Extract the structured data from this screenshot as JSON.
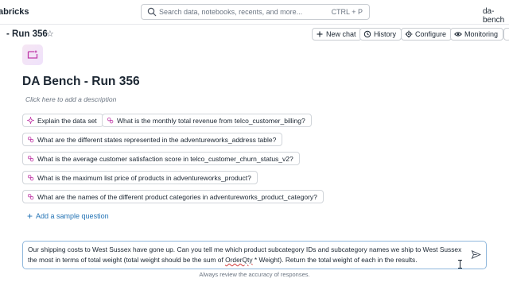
{
  "topbar": {
    "brand": "abricks",
    "search_placeholder": "Search data, notebooks, recents, and more...",
    "search_shortcut": "CTRL + P",
    "workspace": "da-bench"
  },
  "header": {
    "title": "- Run 356",
    "buttons": {
      "new_chat": "New chat",
      "history": "History",
      "configure": "Configure",
      "monitoring": "Monitoring"
    }
  },
  "space": {
    "title": "DA Bench - Run 356",
    "description_hint": "Click here to add a description"
  },
  "sample_questions": [
    {
      "label": "Explain the data set",
      "icon": "sparkle-icon"
    },
    {
      "label": "What is the monthly total revenue from telco_customer_billing?",
      "icon": "question-icon"
    },
    {
      "label": "What are the different states represented in the adventureworks_address table?",
      "icon": "question-icon"
    },
    {
      "label": "What is the average customer satisfaction score in telco_customer_churn_status_v2?",
      "icon": "question-icon"
    },
    {
      "label": "What is the maximum list price of products in adventureworks_product?",
      "icon": "question-icon"
    },
    {
      "label": "What are the names of the different product categories in adventureworks_product_category?",
      "icon": "question-icon"
    }
  ],
  "add_sample_label": "Add a sample question",
  "composer": {
    "text_before": "Our shipping costs to West Sussex have gone up. Can you tell me which product subcategory IDs and subcategory names we ship to West Sussex the most in terms of total weight (total weight should be the sum of ",
    "text_underlined": "OrderQty",
    "text_after": " * Weight). Return the total weight of each in the results."
  },
  "disclaimer": "Always review the accuracy of responses.",
  "colors": {
    "accent": "#2272b4",
    "composer_border": "#8fb7dc",
    "icon_pink": "#c03ba8"
  }
}
